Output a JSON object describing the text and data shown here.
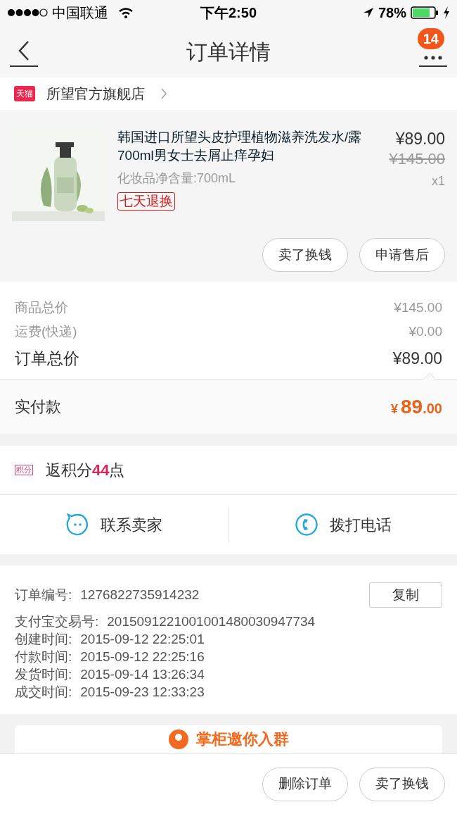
{
  "status_bar": {
    "carrier": "中国联通",
    "time": "下午2:50",
    "battery": "78%"
  },
  "nav": {
    "title": "订单详情",
    "badge": "14"
  },
  "shop": {
    "platform": "天猫",
    "name": "所望官方旗舰店"
  },
  "product": {
    "kind": "picture",
    "title": "韩国进口所望头皮护理植物滋养洗发水/露700ml男女士去屑止痒孕妇",
    "spec": "化妆品净含量:700mL",
    "tag": "七天退换",
    "price": "¥89.00",
    "original_price": "¥145.00",
    "quantity": "x1",
    "actions": [
      "卖了换钱",
      "申请售后"
    ]
  },
  "summary": [
    {
      "label": "商品总价",
      "value": "¥145.00",
      "kind": "minor"
    },
    {
      "label": "运费(快递)",
      "value": "¥0.00",
      "kind": "minor"
    },
    {
      "label": "订单总价",
      "value": "¥89.00",
      "kind": "total"
    }
  ],
  "paid": {
    "label": "实付款",
    "currency": "¥",
    "integer": "89",
    "decimals": ".00"
  },
  "points": {
    "icon_text": "积分",
    "prefix": "返积分",
    "amount": "44",
    "suffix": "点"
  },
  "contact": [
    {
      "kind": "chat",
      "label": "联系卖家"
    },
    {
      "kind": "phone",
      "label": "拨打电话"
    }
  ],
  "order_info": {
    "copy_button": "复制",
    "rows": [
      {
        "label": "订单编号:",
        "value": "1276822735914232"
      },
      {
        "label": "支付宝交易号:",
        "value": "2015091221001001480030947734"
      },
      {
        "label": "创建时间:",
        "value": "2015-09-12 22:25:01"
      },
      {
        "label": "付款时间:",
        "value": "2015-09-12 22:25:16"
      },
      {
        "label": "发货时间:",
        "value": "2015-09-14 13:26:34"
      },
      {
        "label": "成交时间:",
        "value": "2015-09-23 12:33:23"
      }
    ]
  },
  "promo": {
    "title": "掌柜邀你入群"
  },
  "bottom_actions": [
    "删除订单",
    "卖了换钱"
  ]
}
